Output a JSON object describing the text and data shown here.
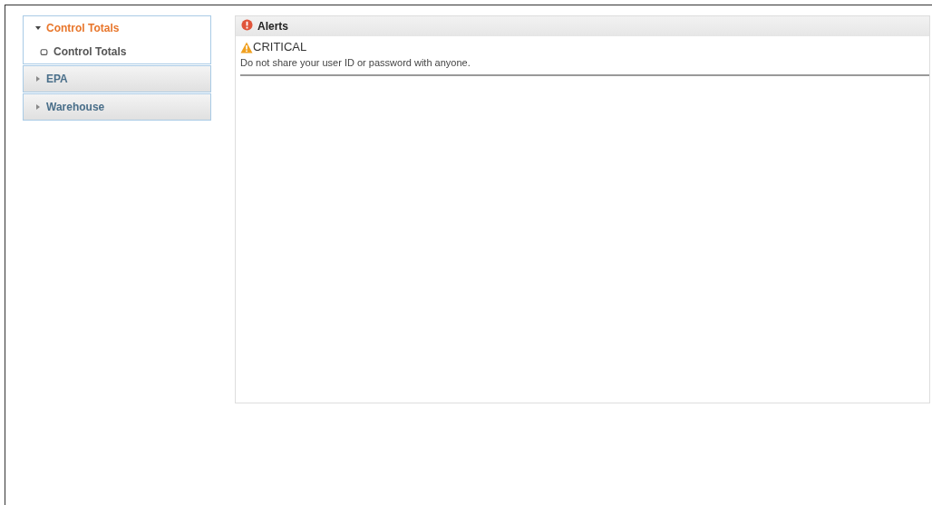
{
  "sidebar": {
    "sections": [
      {
        "label": "Control Totals",
        "expanded": true,
        "children": [
          {
            "label": "Control Totals"
          }
        ]
      },
      {
        "label": "EPA",
        "expanded": false
      },
      {
        "label": "Warehouse",
        "expanded": false
      }
    ]
  },
  "alerts_panel": {
    "title": "Alerts",
    "alerts": [
      {
        "kind": "warning",
        "heading": "CRITICAL",
        "message": "Do not share your user ID or password with anyone."
      }
    ]
  }
}
